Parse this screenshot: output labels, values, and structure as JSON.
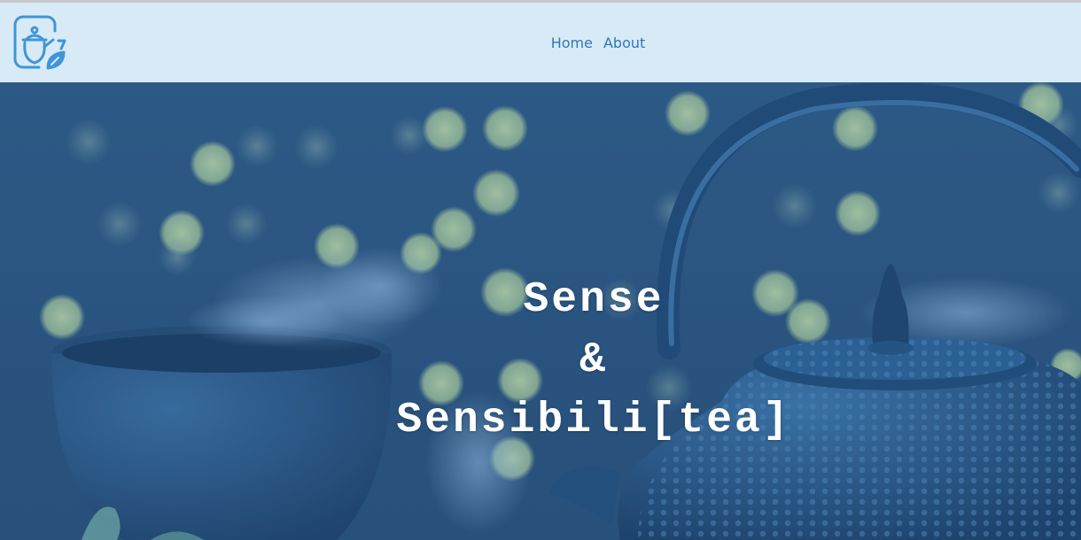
{
  "app": {
    "logo_icon": "teapot-leaf-logo-icon",
    "brand_color": "#3d96d8"
  },
  "nav": {
    "background": "#d9eaf7",
    "link_color": "#2a7ab8",
    "items": [
      {
        "label": "Home"
      },
      {
        "label": "About"
      }
    ]
  },
  "hero": {
    "image_icon": "teapot-and-tea-cup-photo",
    "overlay_color": "#2f5a86",
    "title_lines": [
      "Sense",
      "&",
      "Sensibili[tea]"
    ]
  }
}
